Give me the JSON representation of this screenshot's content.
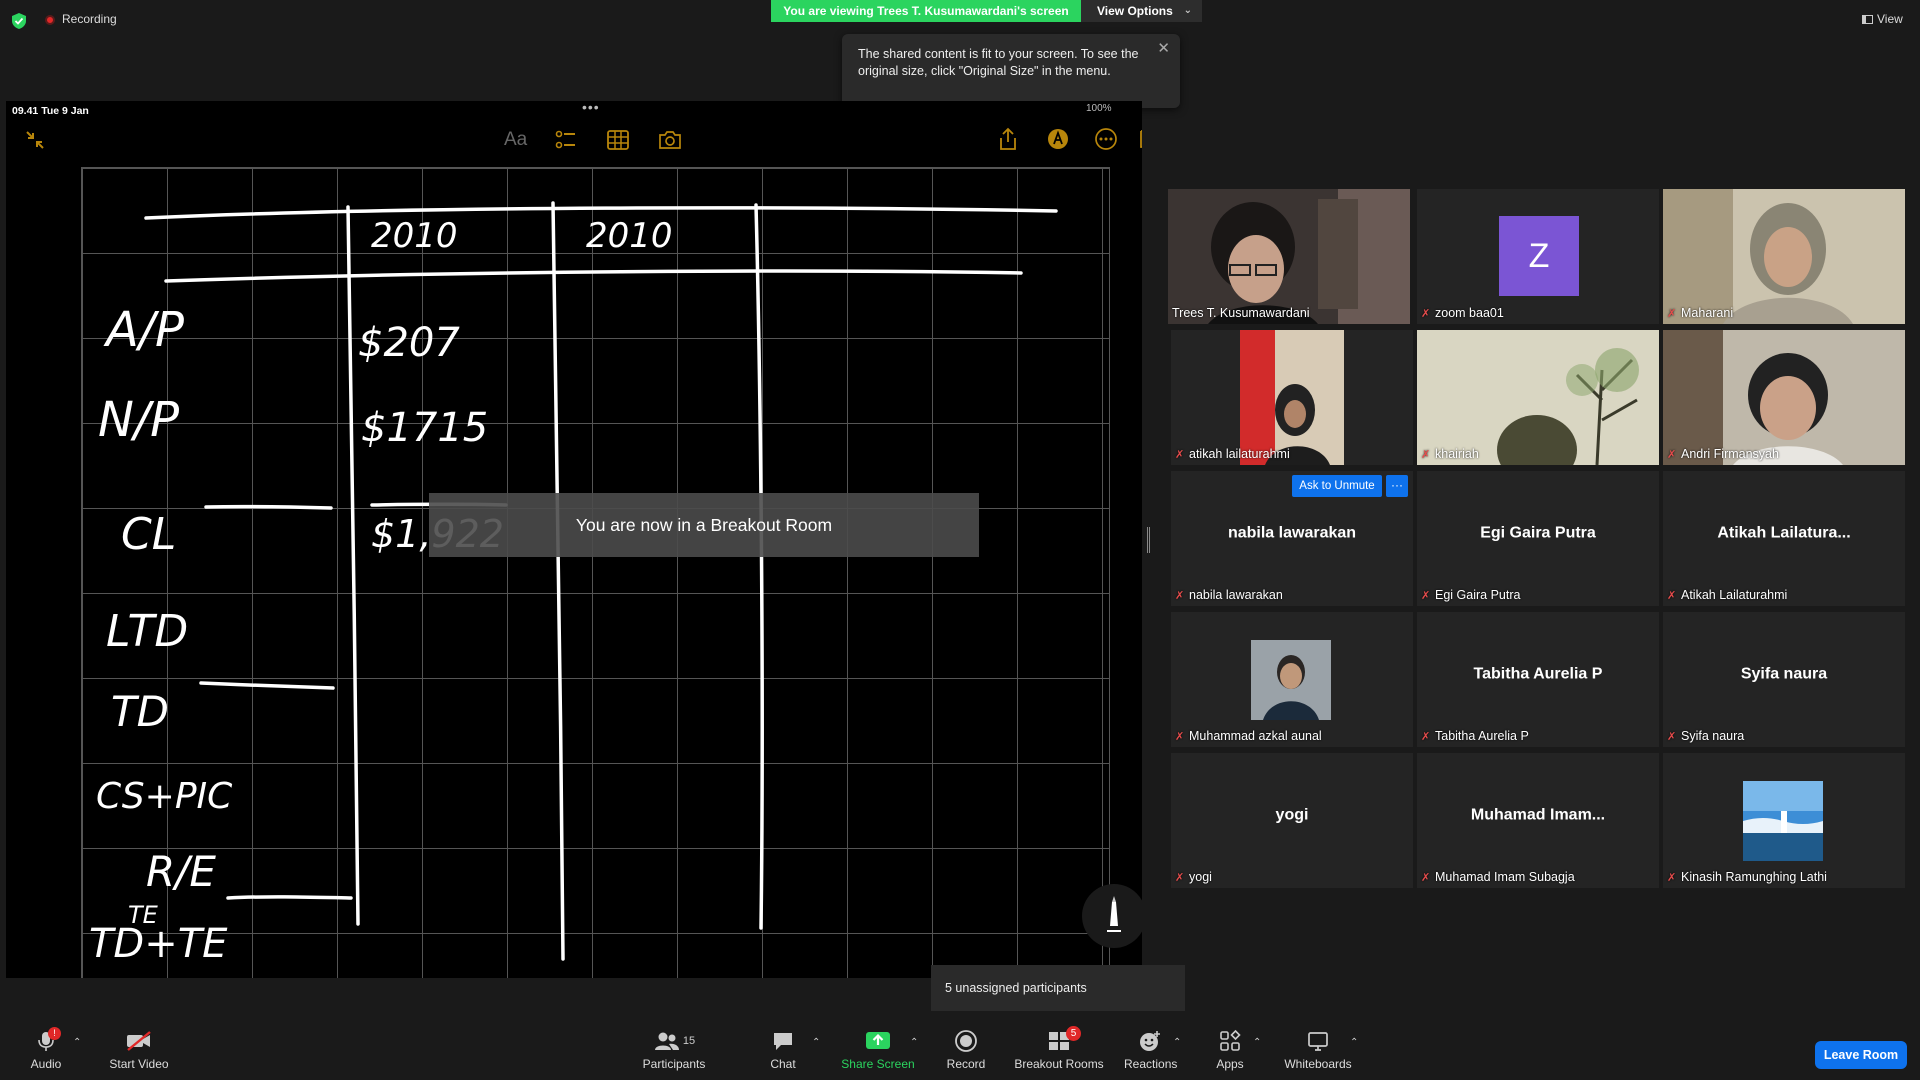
{
  "top": {
    "recording_label": "Recording",
    "viewing_banner": "You are viewing Trees T. Kusumawardani's screen",
    "view_options": "View Options",
    "view_label": "View"
  },
  "tooltip": {
    "text": "The shared content is fit to your screen. To see the original size, click \"Original Size\" in the menu."
  },
  "shared": {
    "time": "09.41   Tue 9 Jan",
    "aa_label": "Aa",
    "battery": "100%",
    "breakout_toast": "You are now in a Breakout Room",
    "handwriting": {
      "col1": "2010",
      "col2": "2010",
      "rows": [
        "A/P",
        "N/P",
        "CL",
        "LTD",
        "TD",
        "CS+PIC",
        "R/E",
        "TE",
        "TD+TE"
      ],
      "values": [
        "$207",
        "$1715",
        "$1,922"
      ]
    }
  },
  "gallery": {
    "tiles": [
      {
        "label": "Trees T. Kusumawardani",
        "muted": false,
        "active": true
      },
      {
        "label": "zoom baa01",
        "muted": true,
        "avatar": "Z"
      },
      {
        "label": "Maharani",
        "muted": true
      },
      {
        "label": "atikah lailaturahmi",
        "muted": true
      },
      {
        "label": "khairiah",
        "muted": true
      },
      {
        "label": "Andri Firmansyah",
        "muted": true
      },
      {
        "label": "nabila lawarakan",
        "center": "nabila lawarakan",
        "muted": true
      },
      {
        "label": "Egi Gaira Putra",
        "center": "Egi Gaira Putra",
        "muted": true
      },
      {
        "label": "Atikah Lailaturahmi",
        "center": "Atikah  Lailatura...",
        "muted": true
      },
      {
        "label": "Muhammad azkal aunal",
        "muted": true
      },
      {
        "label": "Tabitha Aurelia P",
        "center": "Tabitha Aurelia P",
        "muted": true
      },
      {
        "label": "Syifa naura",
        "center": "Syifa naura",
        "muted": true
      },
      {
        "label": "yogi",
        "center": "yogi",
        "muted": true
      },
      {
        "label": "Muhamad Imam Subagja",
        "center": "Muhamad  Imam...",
        "muted": true
      },
      {
        "label": "Kinasih Ramunghing Lathi",
        "muted": true
      }
    ],
    "ask_unmute": "Ask to Unmute",
    "more": "···"
  },
  "unassigned": "5 unassigned participants",
  "toolbar": {
    "audio": "Audio",
    "audio_badge": "!",
    "video": "Start Video",
    "participants": "Participants",
    "participants_count": "15",
    "chat": "Chat",
    "share": "Share Screen",
    "record": "Record",
    "breakout": "Breakout Rooms",
    "breakout_badge": "5",
    "reactions": "Reactions",
    "apps": "Apps",
    "whiteboards": "Whiteboards",
    "leave": "Leave Room"
  },
  "colors": {
    "banner_green": "#2bd45f",
    "active_speaker": "#d8e84a",
    "zoom_blue": "#0e72ed",
    "avatar_purple": "#7b55d4",
    "muted_red": "#e64c4c"
  }
}
